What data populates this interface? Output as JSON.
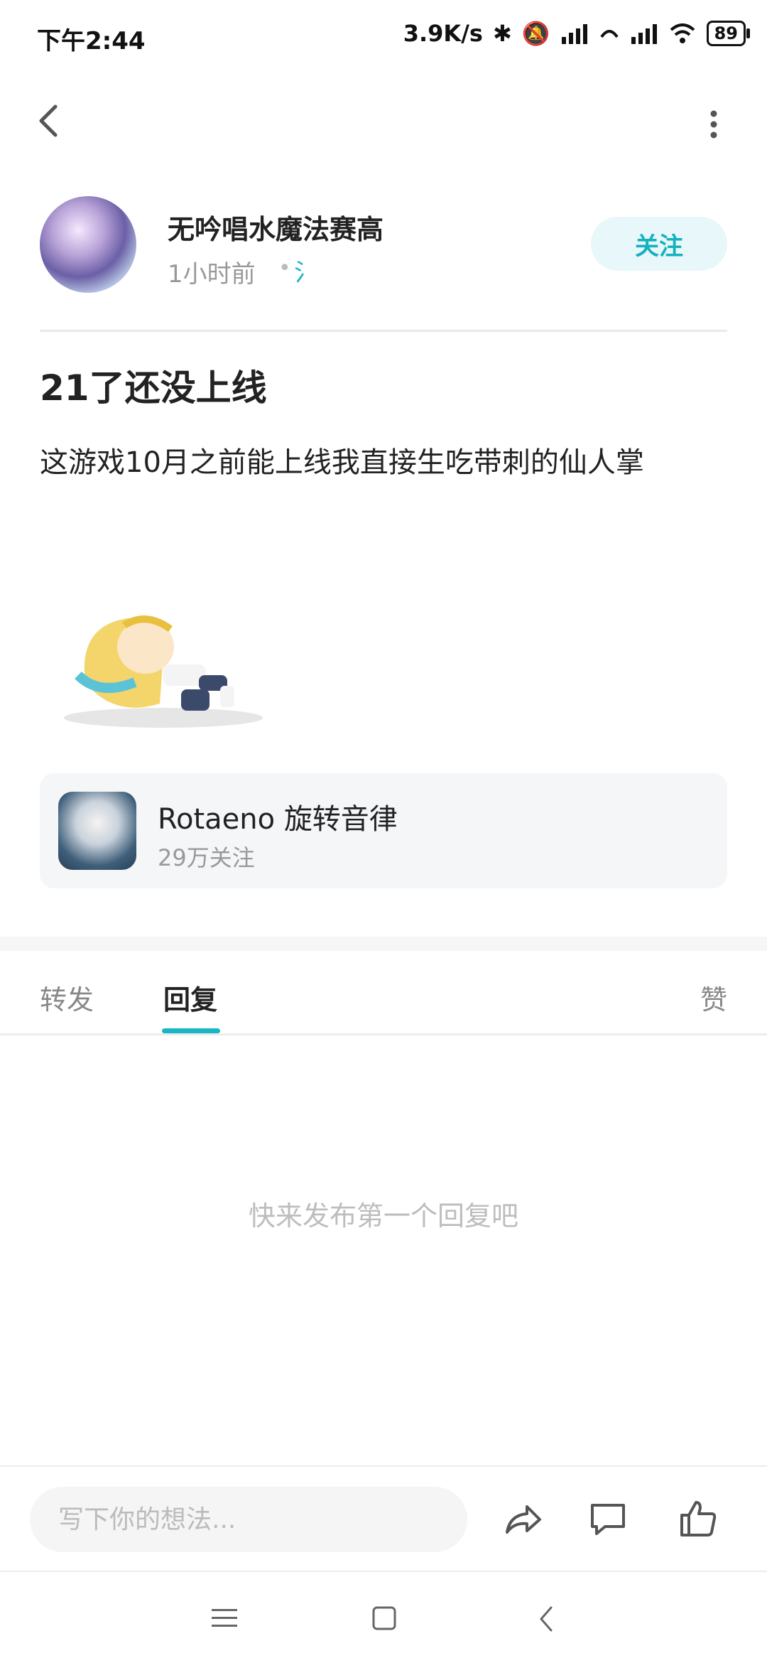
{
  "status_bar": {
    "time": "下午2:44",
    "net_speed": "3.9K/s",
    "battery": "89"
  },
  "author": {
    "name": "无吟唱水魔法赛高",
    "time": "1小时前",
    "source_mark": "氵",
    "follow_label": "关注"
  },
  "post": {
    "title": "21了还没上线",
    "body": "这游戏10月之前能上线我直接生吃带刺的仙人掌"
  },
  "game_card": {
    "name": "Rotaeno 旋转音律",
    "followers": "29万关注"
  },
  "tabs": {
    "repost": "转发",
    "reply": "回复",
    "like": "赞"
  },
  "empty_state": "快来发布第一个回复吧",
  "bottom_bar": {
    "input_placeholder": "写下你的想法..."
  },
  "colors": {
    "accent": "#18b5c5",
    "follow_bg": "#e8f7f9",
    "card_bg": "#f5f6f8"
  }
}
